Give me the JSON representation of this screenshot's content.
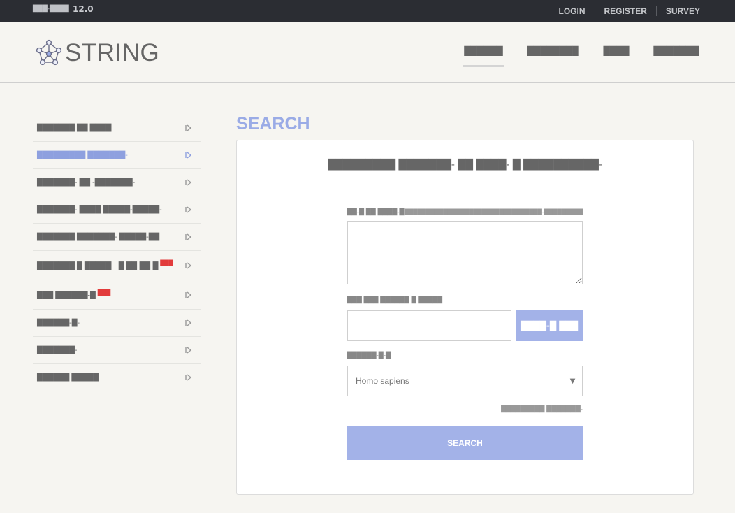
{
  "topbar": {
    "version_label": "███-████",
    "version_number": "12.0",
    "links": [
      "LOGIN",
      "REGISTER",
      "SURVEY"
    ]
  },
  "header": {
    "logo_text": "STRING",
    "nav": [
      "██████",
      "████████",
      "████",
      "███████"
    ]
  },
  "sidebar": {
    "items": [
      {
        "label": "███████ ██ ████",
        "new": ""
      },
      {
        "label": "█████████ ███████-",
        "new": ""
      },
      {
        "label": "███████- ██ -███████-",
        "new": ""
      },
      {
        "label": "███████- ████ █████-█████-",
        "new": ""
      },
      {
        "label": "███████ ███████- █████-██",
        "new": ""
      },
      {
        "label": "███████ █ █████-- █ ██-██-█",
        "new": "███"
      },
      {
        "label": "███ ██████-█",
        "new": "███"
      },
      {
        "label": "██████-█-",
        "new": ""
      },
      {
        "label": "███████-",
        "new": ""
      },
      {
        "label": "██████ █████",
        "new": ""
      }
    ]
  },
  "main": {
    "title": "SEARCH",
    "panel_heading": "█████████ ███████- ██ ████- █ ██████████-",
    "list_label": "██-█ ██ ████-█",
    "example_link": "████████████████████████████████-█████████",
    "file_label": "███ ███ ██████ █ █████",
    "browse_button": "████-█ ███",
    "organism_label": "██████-█-█",
    "organism_value": "Homo sapiens",
    "advanced_link": "█████████ ███████-",
    "search_button": "SEARCH"
  },
  "colors": {
    "accent": "#9aabe6",
    "button": "#a3b2e8",
    "topbar": "#2b2d33",
    "background": "#f6f5f1",
    "new_badge": "#e23b3b"
  },
  "icons": {
    "logo": "network-graph-icon",
    "sidebar_arrow": "chevron-right-icon",
    "select_caret": "caret-down-icon"
  }
}
